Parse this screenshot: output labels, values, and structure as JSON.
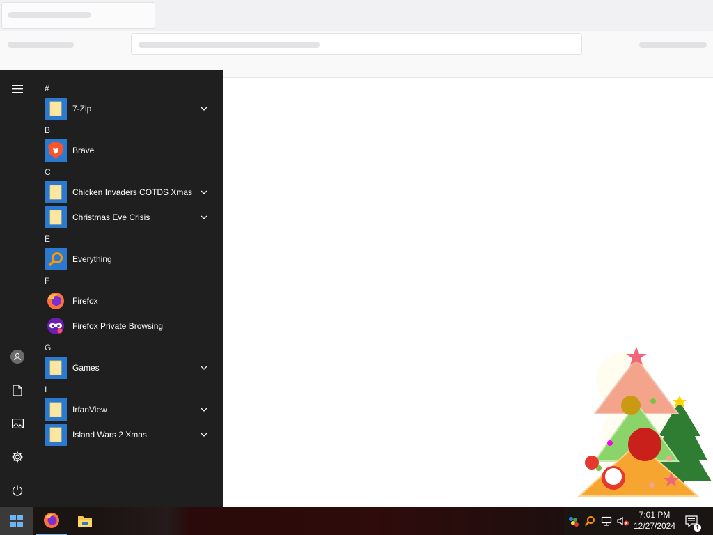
{
  "start_menu": {
    "sections": [
      {
        "letter": "#",
        "apps": [
          {
            "label": "7-Zip",
            "icon": "folder-icon",
            "tile": "blue",
            "expandable": true
          }
        ]
      },
      {
        "letter": "B",
        "apps": [
          {
            "label": "Brave",
            "icon": "brave-icon",
            "tile": "blue",
            "expandable": false
          }
        ]
      },
      {
        "letter": "C",
        "apps": [
          {
            "label": "Chicken Invaders COTDS Xmas",
            "icon": "folder-icon",
            "tile": "blue",
            "expandable": true
          },
          {
            "label": "Christmas Eve Crisis",
            "icon": "folder-icon",
            "tile": "blue",
            "expandable": true
          }
        ]
      },
      {
        "letter": "E",
        "apps": [
          {
            "label": "Everything",
            "icon": "magnifier-icon",
            "tile": "blue",
            "expandable": false
          }
        ]
      },
      {
        "letter": "F",
        "apps": [
          {
            "label": "Firefox",
            "icon": "firefox-icon",
            "tile": "none",
            "expandable": false
          },
          {
            "label": "Firefox Private Browsing",
            "icon": "firefox-private-icon",
            "tile": "none",
            "expandable": false
          }
        ]
      },
      {
        "letter": "G",
        "apps": [
          {
            "label": "Games",
            "icon": "folder-icon",
            "tile": "blue",
            "expandable": true
          }
        ]
      },
      {
        "letter": "I",
        "apps": [
          {
            "label": "IrfanView",
            "icon": "folder-icon",
            "tile": "blue",
            "expandable": true
          },
          {
            "label": "Island Wars 2 Xmas",
            "icon": "folder-icon",
            "tile": "blue",
            "expandable": true
          }
        ]
      }
    ],
    "rail": [
      "hamburger-icon",
      "user-icon",
      "documents-icon",
      "pictures-icon",
      "settings-icon",
      "power-icon"
    ]
  },
  "taskbar": {
    "pinned": [
      "firefox-icon",
      "file-explorer-icon"
    ],
    "tray": [
      "network-status-icon",
      "everything-tray-icon",
      "network-icon",
      "volume-muted-icon"
    ],
    "time": "7:01 PM",
    "date": "12/27/2024",
    "notification_count": "1"
  },
  "colors": {
    "menu_bg": "#1f1f1f",
    "tile_blue": "#2b7ad0",
    "taskbar_bg": "#1a1413"
  }
}
